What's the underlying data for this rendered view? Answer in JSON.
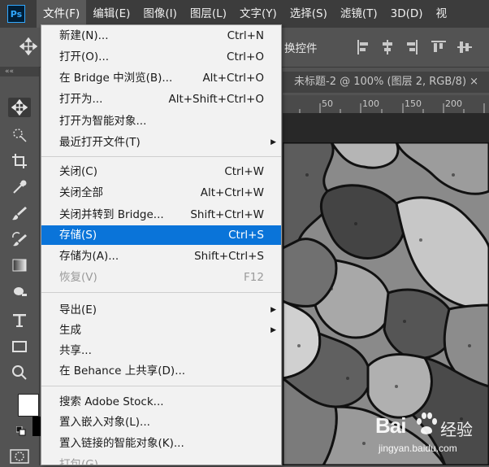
{
  "app_logo": "Ps",
  "menubar": [
    "文件(F)",
    "编辑(E)",
    "图像(I)",
    "图层(L)",
    "文字(Y)",
    "选择(S)",
    "滤镜(T)",
    "3D(D)",
    "视"
  ],
  "optionsbar": {
    "transform_controls_label": "换控件"
  },
  "toolbox": {
    "collapse_label": "««"
  },
  "document": {
    "tab_title": "未标题-2 @ 100% (图层 2, RGB/8) ×",
    "ruler_ticks": [
      "50",
      "100",
      "150",
      "200"
    ]
  },
  "file_menu": {
    "items": [
      {
        "label": "新建(N)...",
        "shortcut": "Ctrl+N"
      },
      {
        "label": "打开(O)...",
        "shortcut": "Ctrl+O"
      },
      {
        "label": "在 Bridge 中浏览(B)...",
        "shortcut": "Alt+Ctrl+O"
      },
      {
        "label": "打开为...",
        "shortcut": "Alt+Shift+Ctrl+O"
      },
      {
        "label": "打开为智能对象...",
        "shortcut": ""
      },
      {
        "label": "最近打开文件(T)",
        "shortcut": "",
        "submenu": true
      },
      {
        "label": "关闭(C)",
        "shortcut": "Ctrl+W"
      },
      {
        "label": "关闭全部",
        "shortcut": "Alt+Ctrl+W"
      },
      {
        "label": "关闭并转到 Bridge...",
        "shortcut": "Shift+Ctrl+W"
      },
      {
        "label": "存储(S)",
        "shortcut": "Ctrl+S",
        "highlighted": true
      },
      {
        "label": "存储为(A)...",
        "shortcut": "Shift+Ctrl+S"
      },
      {
        "label": "恢复(V)",
        "shortcut": "F12",
        "disabled": true
      },
      {
        "label": "导出(E)",
        "shortcut": "",
        "submenu": true
      },
      {
        "label": "生成",
        "shortcut": "",
        "submenu": true
      },
      {
        "label": "共享...",
        "shortcut": ""
      },
      {
        "label": "在 Behance 上共享(D)...",
        "shortcut": ""
      },
      {
        "label": "搜索 Adobe Stock...",
        "shortcut": ""
      },
      {
        "label": "置入嵌入对象(L)...",
        "shortcut": ""
      },
      {
        "label": "置入链接的智能对象(K)...",
        "shortcut": ""
      },
      {
        "label": "打包(G)...",
        "shortcut": "",
        "disabled": true
      }
    ]
  },
  "watermark": {
    "brand": "Bai",
    "brand_suffix": "经验",
    "url": "jingyan.baidu.com"
  },
  "colors": {
    "highlight": "#0a74d9",
    "menu_bg": "#f2f2f2",
    "menubar_bg": "#3c3c3c",
    "panel_bg": "#535353",
    "ps_blue": "#31a8ff"
  }
}
